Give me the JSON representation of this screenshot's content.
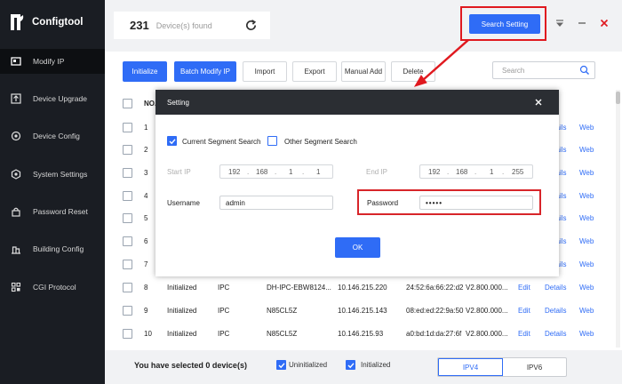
{
  "app": {
    "title": "Configtool"
  },
  "sidebar": {
    "items": [
      {
        "label": "Modify IP",
        "icon": "modify-ip-icon",
        "active": true
      },
      {
        "label": "Device Upgrade",
        "icon": "upgrade-icon"
      },
      {
        "label": "Device Config",
        "icon": "config-icon"
      },
      {
        "label": "System Settings",
        "icon": "settings-icon"
      },
      {
        "label": "Password Reset",
        "icon": "password-icon"
      },
      {
        "label": "Building Config",
        "icon": "building-icon"
      },
      {
        "label": "CGI Protocol",
        "icon": "cgi-icon"
      }
    ]
  },
  "header": {
    "device_count": "231",
    "device_count_label": "Device(s) found",
    "search_setting_label": "Search Setting"
  },
  "toolbar": {
    "initialize": "Initialize",
    "batch_modify_ip": "Batch Modify IP",
    "import": "Import",
    "export": "Export",
    "manual_add": "Manual Add",
    "delete": "Delete",
    "search_placeholder": "Search"
  },
  "table": {
    "header_no": "NO.",
    "rows": [
      {
        "no": "1",
        "edit": "",
        "details": "Details",
        "web": "Web"
      },
      {
        "no": "2",
        "edit": "",
        "details": "Details",
        "web": "Web"
      },
      {
        "no": "3",
        "edit": "",
        "details": "Details",
        "web": "Web"
      },
      {
        "no": "4",
        "edit": "",
        "details": "Details",
        "web": "Web"
      },
      {
        "no": "5",
        "edit": "",
        "details": "Details",
        "web": "Web"
      },
      {
        "no": "6",
        "edit": "",
        "details": "Details",
        "web": "Web"
      },
      {
        "no": "7",
        "edit": "",
        "details": "Details",
        "web": "Web"
      },
      {
        "no": "8",
        "status": "Initialized",
        "type": "IPC",
        "model": "DH-IPC-EBW8124...",
        "ip": "10.146.215.220",
        "mac": "24:52:6a:66:22:d2",
        "version": "V2.800.000...",
        "edit": "Edit",
        "details": "Details",
        "web": "Web"
      },
      {
        "no": "9",
        "status": "Initialized",
        "type": "IPC",
        "model": "N85CL5Z",
        "ip": "10.146.215.143",
        "mac": "08:ed:ed:22:9a:50",
        "version": "V2.800.000...",
        "edit": "Edit",
        "details": "Details",
        "web": "Web"
      },
      {
        "no": "10",
        "status": "Initialized",
        "type": "IPC",
        "model": "N85CL5Z",
        "ip": "10.146.215.93",
        "mac": "a0:bd:1d:da:27:6f",
        "version": "V2.800.000...",
        "edit": "Edit",
        "details": "Details",
        "web": "Web"
      }
    ]
  },
  "footer": {
    "selected_prefix": "You have selected",
    "selected_count": "0",
    "selected_suffix": "device(s)",
    "uninitialized": "Uninitialized",
    "initialized": "Initialized",
    "ipv4": "IPV4",
    "ipv6": "IPV6"
  },
  "dialog": {
    "title": "Setting",
    "current_segment": "Current Segment Search",
    "other_segment": "Other Segment Search",
    "start_ip_label": "Start IP",
    "start_ip": [
      "192",
      "168",
      "1",
      "1"
    ],
    "end_ip_label": "End IP",
    "end_ip": [
      "192",
      "168",
      "1",
      "255"
    ],
    "username_label": "Username",
    "username": "admin",
    "password_label": "Password",
    "password": "•••••",
    "ok": "OK"
  },
  "colors": {
    "accent": "#2f6cf6",
    "highlight": "#e0191f",
    "sidebar": "#1a1d23"
  }
}
